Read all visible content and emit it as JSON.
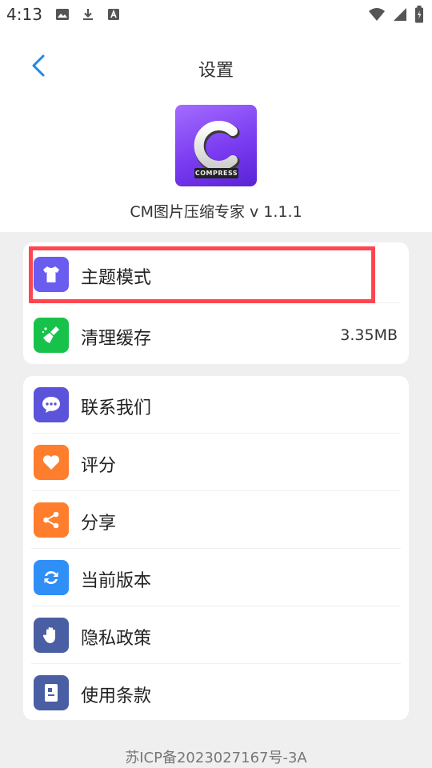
{
  "status_bar": {
    "time": "4:13",
    "left_icons": [
      "image-icon",
      "download-icon",
      "a-badge-icon"
    ],
    "right_icons": [
      "wifi-icon",
      "signal-icon",
      "battery-icon"
    ]
  },
  "header": {
    "title": "设置",
    "back_icon": "chevron-left-icon"
  },
  "app": {
    "logo_letter": "C",
    "logo_badge": "COMPRESS",
    "name_version": "CM图片压缩专家 v 1.1.1"
  },
  "group1": [
    {
      "label": "主题模式",
      "icon": "tshirt-icon",
      "color": "#6b5cf0",
      "value": ""
    },
    {
      "label": "清理缓存",
      "icon": "broom-icon",
      "color": "#17c24b",
      "value": "3.35MB"
    }
  ],
  "group2": [
    {
      "label": "联系我们",
      "icon": "chat-icon",
      "color": "#5b53d9"
    },
    {
      "label": "评分",
      "icon": "heart-icon",
      "color": "#ff7e2e"
    },
    {
      "label": "分享",
      "icon": "share-icon",
      "color": "#ff7e2e"
    },
    {
      "label": "当前版本",
      "icon": "refresh-icon",
      "color": "#2f8ff7"
    },
    {
      "label": "隐私政策",
      "icon": "hand-icon",
      "color": "#4a5fa3"
    },
    {
      "label": "使用条款",
      "icon": "document-icon",
      "color": "#4a5fa3"
    }
  ],
  "footer": {
    "icp": "苏ICP备2023027167号-3A"
  },
  "colors": {
    "accent": "#1e88e5",
    "highlight": "#ff4650",
    "background": "#efefef"
  }
}
